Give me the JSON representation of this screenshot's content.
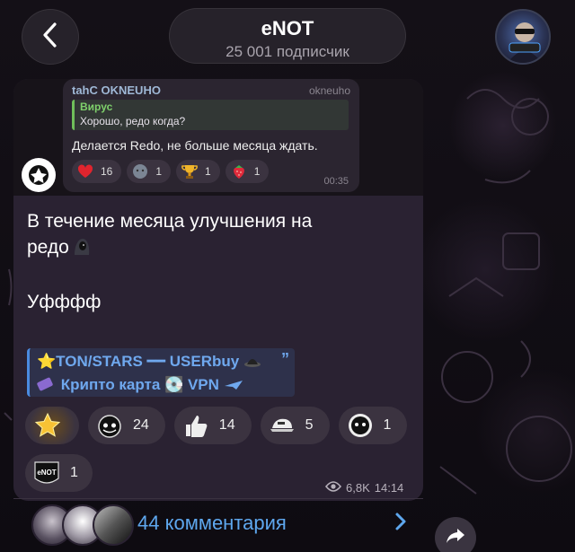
{
  "header": {
    "channel_name": "eNOT",
    "subscribers": "25 001 подписчик"
  },
  "forwarded": {
    "author": "tahC OKNEUHO",
    "handle": "okneuho",
    "quote_name": "Вирус",
    "quote_text": "Хорошо, редо когда?",
    "message": "Делается Redo, не больше месяца ждать.",
    "reactions": [
      {
        "icon": "heart-icon",
        "count": "16"
      },
      {
        "icon": "moon-face-icon",
        "count": "1"
      },
      {
        "icon": "trophy-icon",
        "count": "1"
      },
      {
        "icon": "strawberry-icon",
        "count": "1"
      }
    ],
    "time": "00:35"
  },
  "post": {
    "line1": "В течение месяца улучшения на",
    "line2": "редо",
    "line3": "Уфффф",
    "promo_line1": "⭐TON/STARS ━━ USERbuy",
    "promo_line2": "Крипто карта 💽 VPN"
  },
  "reactions": [
    {
      "icon": "star-icon",
      "count": ""
    },
    {
      "icon": "cat-face-icon",
      "count": "24"
    },
    {
      "icon": "thumbs-up-icon",
      "count": "14"
    },
    {
      "icon": "cap-icon",
      "count": "5"
    },
    {
      "icon": "cat-badge-icon",
      "count": "1"
    },
    {
      "icon": "enot-badge-icon",
      "count": "1"
    }
  ],
  "meta": {
    "views": "6,8K",
    "time": "14:14"
  },
  "comments": {
    "label": "44 комментария"
  },
  "colors": {
    "accent": "#5ea7ee",
    "bubble": "#2a2232",
    "reaction_bg": "#3b3340"
  }
}
